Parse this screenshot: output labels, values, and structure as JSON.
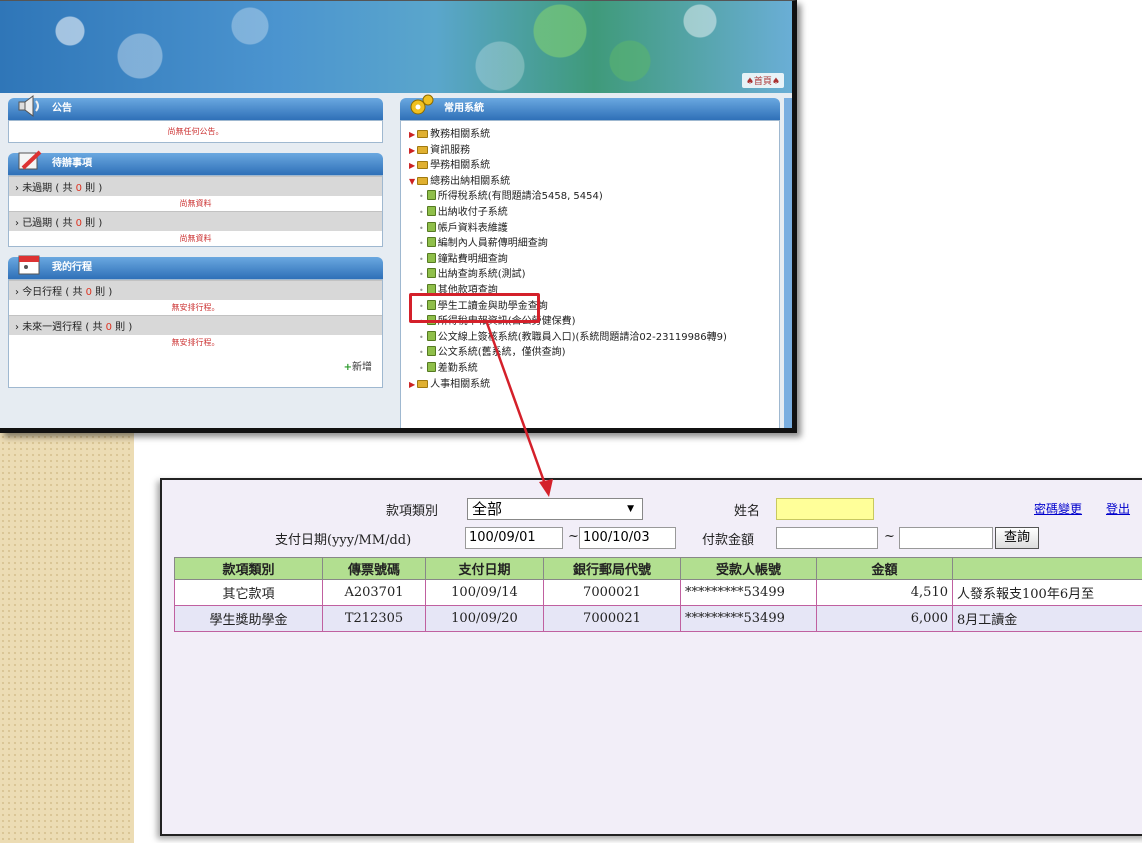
{
  "portal": {
    "home_link": "♠首頁♠",
    "announcement": {
      "title": "公告",
      "message": "尚無任何公告。"
    },
    "pending": {
      "title": "待辦事項",
      "items": [
        {
          "label": "未過期 ( 共 ",
          "count": "0",
          "suffix": " 則 )",
          "empty": "尚無資料"
        },
        {
          "label": "已過期 ( 共 ",
          "count": "0",
          "suffix": " 則 )",
          "empty": "尚無資料"
        }
      ]
    },
    "schedule": {
      "title": "我的行程",
      "items": [
        {
          "label": "今日行程 ( 共 ",
          "count": "0",
          "suffix": " 則 )",
          "empty": "無安排行程。"
        },
        {
          "label": "未來一週行程 ( 共 ",
          "count": "0",
          "suffix": " 則 )",
          "empty": "無安排行程。"
        }
      ],
      "add_label": "新增"
    },
    "systems": {
      "title": "常用系統",
      "menu": [
        {
          "type": "folder",
          "label": "教務相關系統"
        },
        {
          "type": "folder",
          "label": "資訊服務"
        },
        {
          "type": "folder",
          "label": "學務相關系統"
        },
        {
          "type": "folder-open",
          "label": "總務出納相關系統"
        },
        {
          "type": "doc",
          "label": "所得稅系統(有問題請洽5458, 5454)"
        },
        {
          "type": "doc",
          "label": "出納收付子系統"
        },
        {
          "type": "doc",
          "label": "帳戶資料表維護"
        },
        {
          "type": "doc",
          "label": "編制內人員薪傳明細查詢"
        },
        {
          "type": "doc",
          "label": "鐘點費明細查詢"
        },
        {
          "type": "doc",
          "label": "出納查詢系統(測試)"
        },
        {
          "type": "doc",
          "label": "其他款項查詢"
        },
        {
          "type": "doc",
          "label": "學生工讀金與助學金查詢"
        },
        {
          "type": "doc",
          "label": "所得稅申報資訊(含公勞健保費)"
        },
        {
          "type": "doc-wrap",
          "label": "公文線上簽核系統(教職員入口)(系統問題請洽02-23119986轉9)"
        },
        {
          "type": "doc",
          "label": "公文系統(舊系統，僅供查詢)"
        },
        {
          "type": "doc",
          "label": "差勤系統"
        },
        {
          "type": "folder",
          "label": "人事相關系統"
        }
      ]
    }
  },
  "query": {
    "labels": {
      "category": "款項類別",
      "name": "姓名",
      "date_range": "支付日期(yyy/MM/dd)",
      "amount": "付款金額",
      "tilde": "~"
    },
    "category_value": "全部",
    "date_from": "100/09/01",
    "date_to": "100/10/03",
    "search_button": "查詢",
    "links": {
      "password": "密碼變更",
      "logout": "登出"
    },
    "table": {
      "headers": [
        "款項類別",
        "傳票號碼",
        "支付日期",
        "銀行郵局代號",
        "受款人帳號",
        "金額",
        ""
      ],
      "rows": [
        [
          "其它款項",
          "A203701",
          "100/09/14",
          "7000021",
          "*********53499",
          "4,510",
          "人發系報支100年6月至"
        ],
        [
          "學生獎助學金",
          "T212305",
          "100/09/20",
          "7000021",
          "*********53499",
          "6,000",
          "8月工讀金"
        ]
      ]
    }
  }
}
